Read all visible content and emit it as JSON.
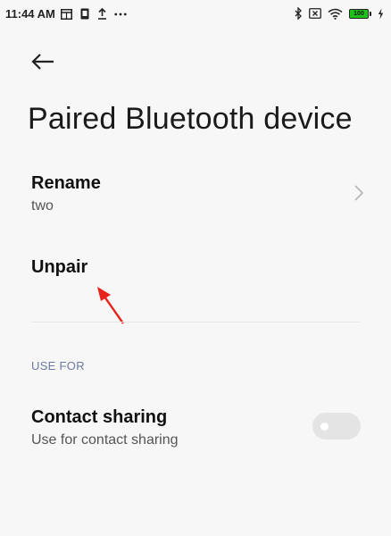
{
  "status_bar": {
    "time": "11:44 AM",
    "battery_level": "100",
    "left_icons": [
      "calendar-icon",
      "sim-icon",
      "upload-icon",
      "more-dots-icon"
    ],
    "right_icons": [
      "bluetooth-icon",
      "no-sim-icon",
      "wifi-icon",
      "battery-icon",
      "charging-icon"
    ]
  },
  "header": {
    "back_icon": "back-arrow-icon",
    "title": "Paired Bluetooth device"
  },
  "rename": {
    "label": "Rename",
    "value": "two"
  },
  "unpair": {
    "label": "Unpair"
  },
  "use_for": {
    "section_label": "USE FOR",
    "items": [
      {
        "label": "Contact sharing",
        "description": "Use for contact sharing",
        "enabled": false
      }
    ]
  },
  "colors": {
    "background": "#f7f7f7",
    "section_header": "#6b7aa1",
    "battery": "#1fc21a",
    "annotation": "#e8231b",
    "toggle_off": "#e4e4e4"
  }
}
